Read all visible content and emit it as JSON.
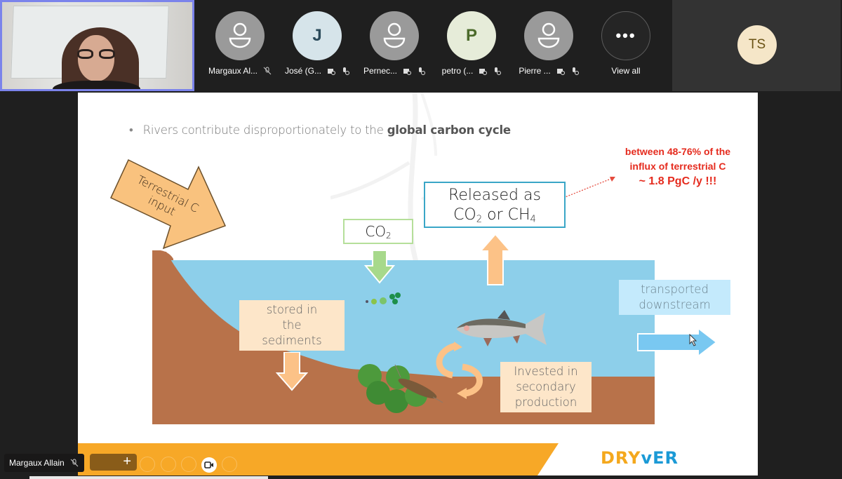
{
  "app": "Microsoft Teams meeting",
  "self_view": {
    "label": "self-video"
  },
  "participants": [
    {
      "name": "Margaux Al...",
      "avatar": "person-icon",
      "status_icons": [
        "mic-off-icon"
      ]
    },
    {
      "name": "José (G...",
      "initial": "J",
      "status_icons": [
        "camera-off-icon",
        "mic-off-icon"
      ]
    },
    {
      "name": "Pernec...",
      "avatar": "person-icon",
      "status_icons": [
        "camera-off-icon",
        "mic-off-icon"
      ]
    },
    {
      "name": "petro (...",
      "initial": "P",
      "status_icons": [
        "camera-off-icon",
        "mic-off-icon"
      ]
    },
    {
      "name": "Pierre ...",
      "avatar": "person-icon",
      "status_icons": [
        "camera-off-icon",
        "mic-off-icon"
      ]
    },
    {
      "name": "View all",
      "glyph": "•••"
    }
  ],
  "presenter_tile": {
    "initials": "TS"
  },
  "slide": {
    "bullet_prefix": "Rivers contribute disproportionately to the ",
    "bullet_bold": "global carbon cycle",
    "note": {
      "line1": "between 48-76% of the",
      "line2": "influx of terrestrial C",
      "line3": "~ 1.8 PgC /y !!!",
      "color": "#e52b1e"
    },
    "terrestrial_line1": "Terrestrial C",
    "terrestrial_line2": "input",
    "released_line1": "Released as",
    "released_co": "CO",
    "released_co_sub": "2",
    "released_or": " or CH",
    "released_ch_sub": "4",
    "co2_label": "CO",
    "co2_sub": "2",
    "stored_line1": "stored in",
    "stored_line2": "the",
    "stored_line3": "sediments",
    "invested_line1": "Invested in",
    "invested_line2": "secondary",
    "invested_line3": "production",
    "transported_line1": "transported",
    "transported_line2": "downstream",
    "logo_part1": "DRY",
    "logo_part2": "vER"
  },
  "bottom": {
    "speaker_name": "Margaux Allain",
    "add_glyph": "+"
  }
}
